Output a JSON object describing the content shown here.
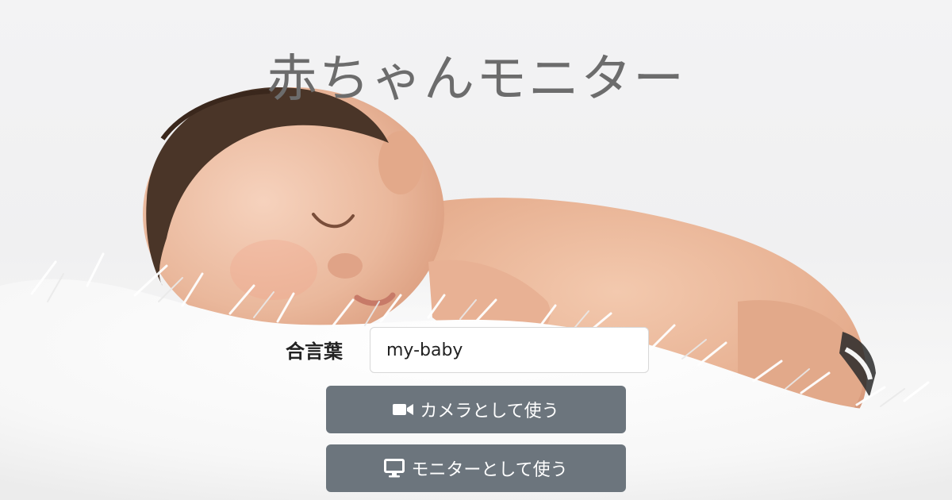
{
  "page": {
    "title": "赤ちゃんモニター"
  },
  "form": {
    "password_label": "合言葉",
    "password_value": "my-baby"
  },
  "buttons": {
    "camera": {
      "label": "カメラとして使う",
      "icon": "video-camera-icon"
    },
    "monitor": {
      "label": "モニターとして使う",
      "icon": "desktop-monitor-icon"
    }
  },
  "colors": {
    "button_bg": "#6c757d",
    "button_text": "#ffffff",
    "title_text": "#6c6c6c",
    "label_text": "#222222"
  }
}
